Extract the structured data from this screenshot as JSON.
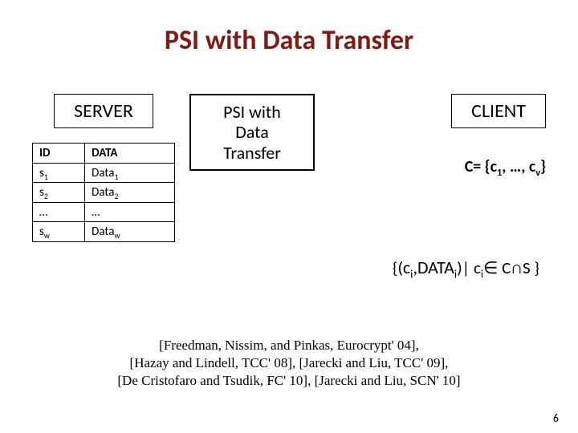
{
  "title": "PSI with Data Transfer",
  "server_label": "SERVER",
  "psi_box_l1": "PSI with",
  "psi_box_l2": "Data Transfer",
  "client_label": "CLIENT",
  "table": {
    "h1": "ID",
    "h2": "DATA",
    "r1c1_base": "s",
    "r1c1_sub": "1",
    "r1c2_base": "Data",
    "r1c2_sub": "1",
    "r2c1_base": "s",
    "r2c1_sub": "2",
    "r2c2_base": "Data",
    "r2c2_sub": "2",
    "r3c1": "…",
    "r3c2": "…",
    "r4c1_base": "s",
    "r4c1_sub": "w",
    "r4c2_base": "Data",
    "r4c2_sub": "w"
  },
  "client_set": {
    "pre": "C= {c",
    "sub1": "1",
    "mid": ", …, c",
    "sub2": "v",
    "post": "}"
  },
  "result": {
    "open": "{(",
    "c": "c",
    "ci_sub": "i",
    "comma": ",",
    "DATA": "DATA",
    "di_sub": "i",
    "bar": ")| ",
    "c2": "c",
    "ci2_sub": "i",
    "in": "∈ ",
    "CS": " C∩S }"
  },
  "refs": {
    "l1": "[Freedman, Nissim, and Pinkas, Eurocrypt' 04],",
    "l2": "[Hazay and Lindell, TCC' 08], [Jarecki and Liu, TCC' 09],",
    "l3": "[De Cristofaro and Tsudik, FC' 10], [Jarecki and Liu, SCN' 10]"
  },
  "page": "6"
}
